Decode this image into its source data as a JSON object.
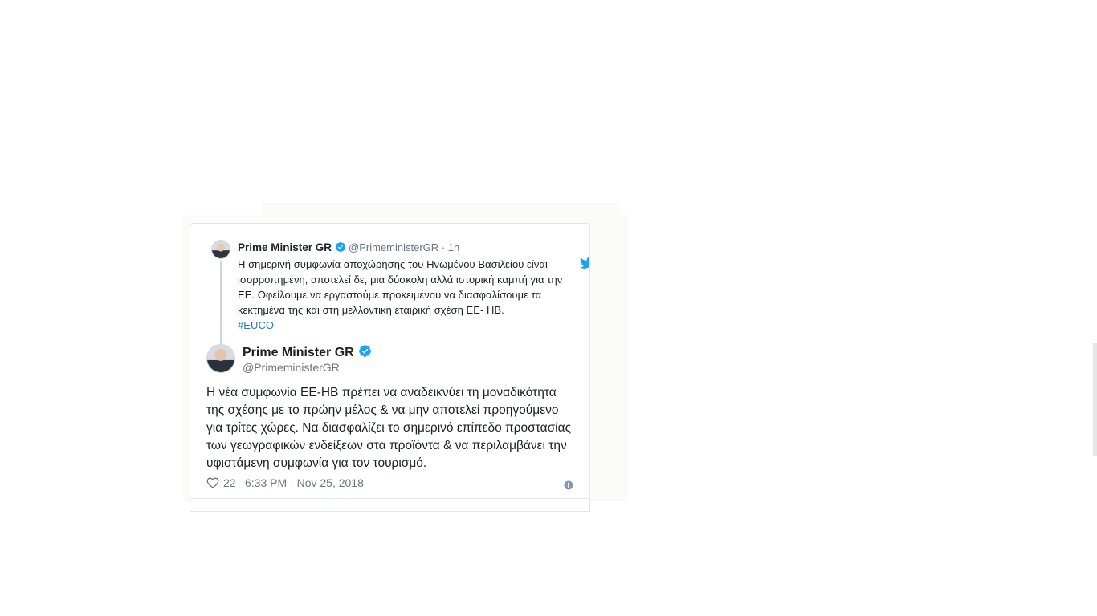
{
  "parent_tweet": {
    "author_name": "Prime Minister GR",
    "handle": "@PrimeministerGR",
    "separator": "·",
    "time": "1h",
    "text": "Η σημερινή συμφωνία αποχώρησης του Ηνωμένου Βασιλείου είναι ισορροπημένη, αποτελεί δε, μια δύσκολη αλλά ιστορική καμπή για την ΕΕ. Οφείλουμε να εργαστούμε προκειμένου να διασφαλίσουμε τα κεκτημένα της και στη μελλοντική εταιρική σχέση ΕΕ- ΗΒ.",
    "hashtag": "#EUCO"
  },
  "main_tweet": {
    "author_name": "Prime Minister GR",
    "handle": "@PrimeministerGR",
    "text": "Η νέα συμφωνία ΕΕ-ΗΒ πρέπει να αναδεικνύει τη μοναδικότητα της σχέσης με το πρώην μέλος & να μην αποτελεί προηγούμενο για τρίτες χώρες. Να διασφαλίζει το σημερινό επίπεδο προστασίας των γεωγραφικών ενδείξεων στα προϊόντα & να περιλαμβάνει την υφιστάμενη συμφωνία για τον τουρισμό.",
    "likes": "22",
    "timestamp": "6:33 PM - Nov 25, 2018"
  },
  "icons": {
    "verified": "verified-badge-icon",
    "brand": "twitter-bird-icon",
    "like": "heart-icon",
    "info": "info-icon"
  },
  "colors": {
    "verified": "#1da1f2",
    "brand": "#1da1f2",
    "link": "#2b7bb9",
    "text": "#1c2022",
    "muted": "#697882",
    "border": "#e1e8ed"
  }
}
